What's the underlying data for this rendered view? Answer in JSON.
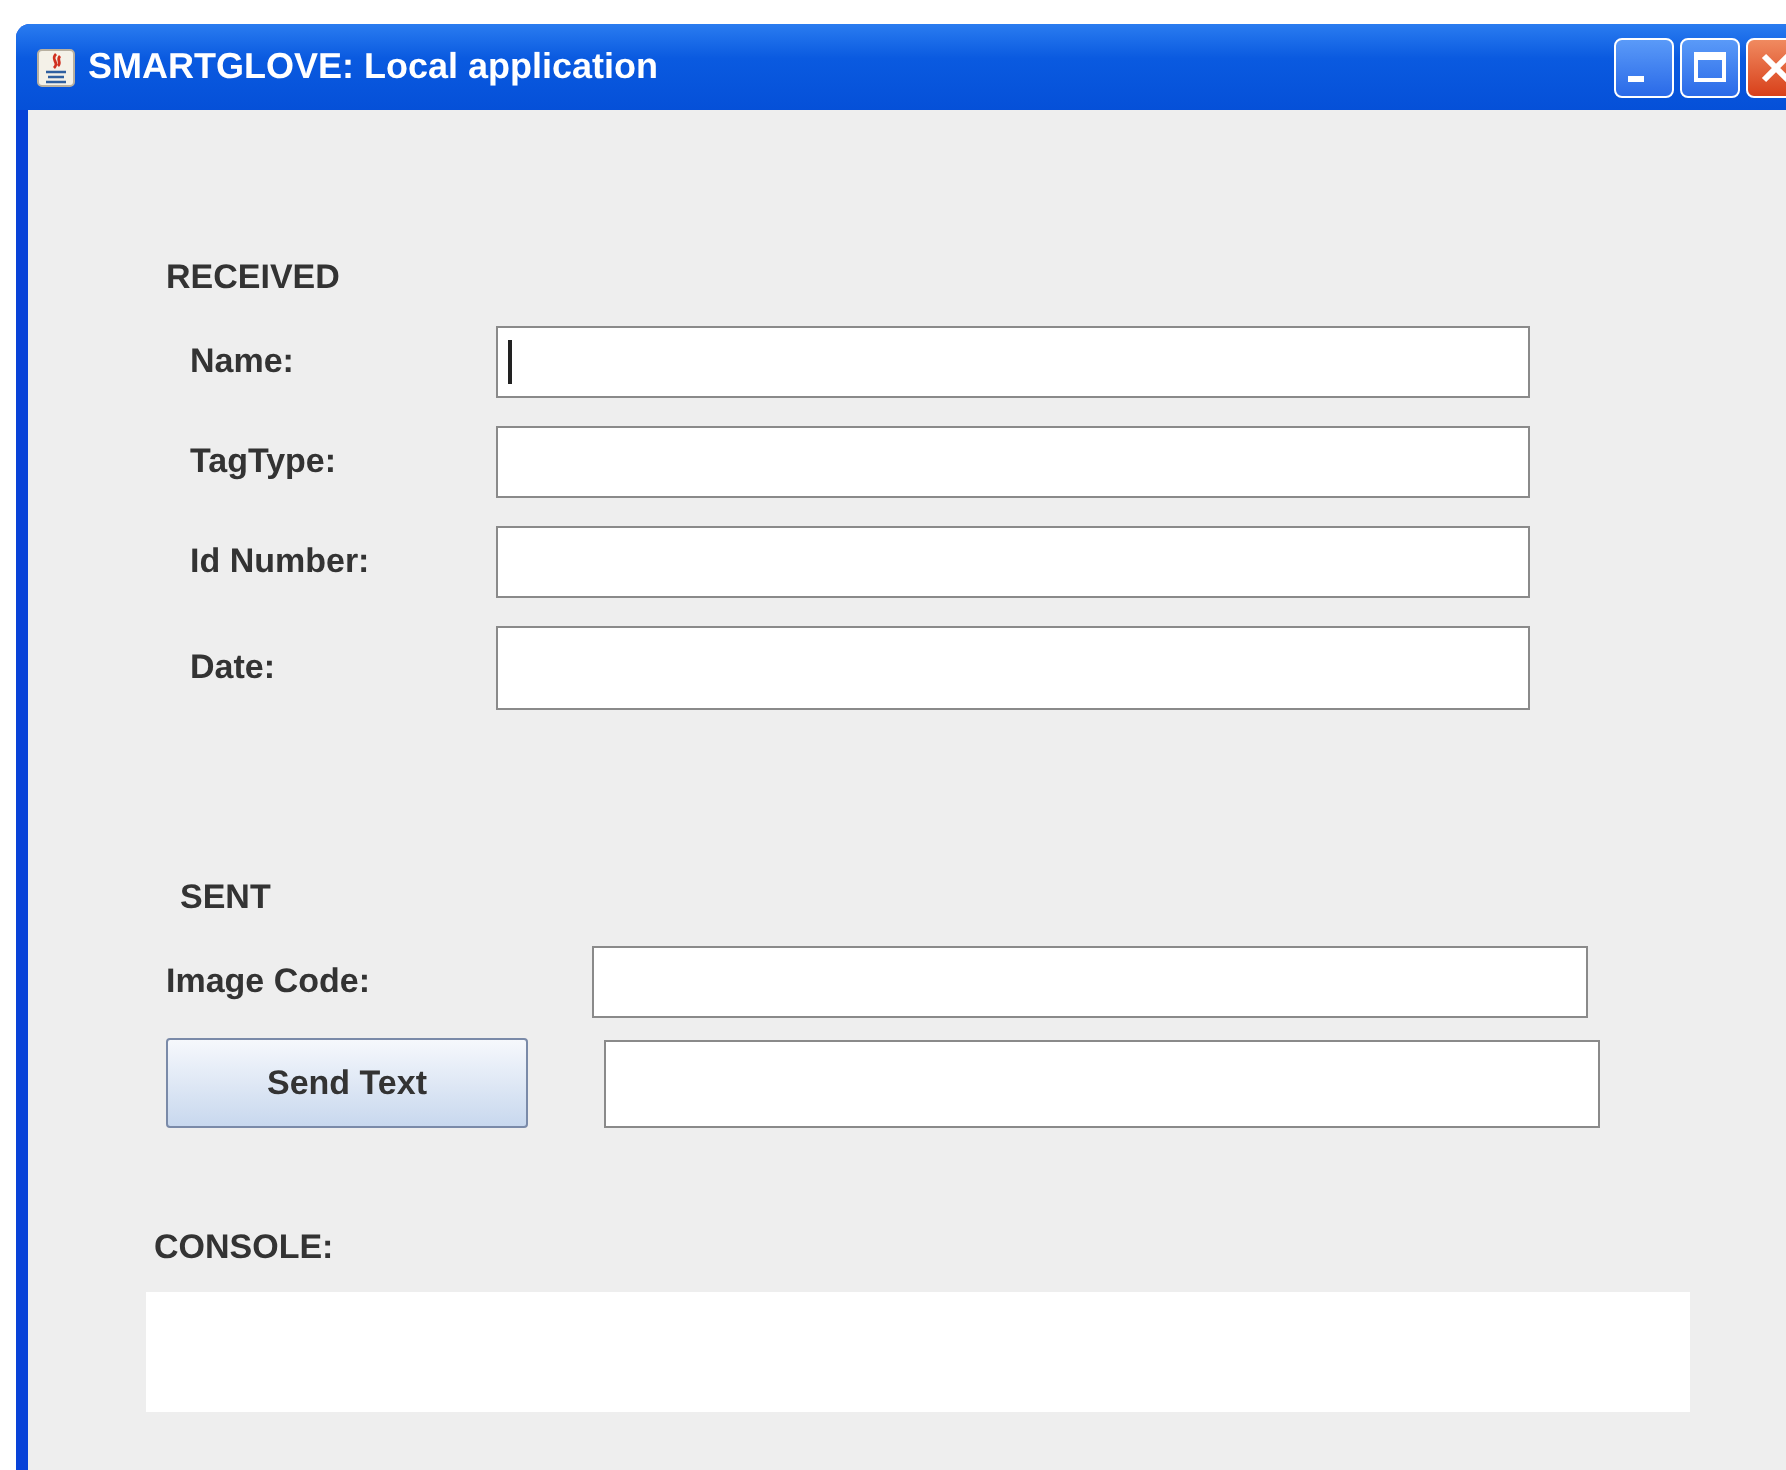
{
  "window": {
    "title": "SMARTGLOVE: Local application"
  },
  "received": {
    "heading": "RECEIVED",
    "fields": [
      {
        "label": "Name:",
        "focused": true
      },
      {
        "label": "TagType:",
        "focused": false
      },
      {
        "label": "Id Number:",
        "focused": false
      },
      {
        "label": "Date:",
        "focused": false
      }
    ]
  },
  "sent": {
    "heading": "SENT",
    "image_code_label": "Image Code:",
    "send_button": "Send Text"
  },
  "console": {
    "label": "CONSOLE:"
  }
}
